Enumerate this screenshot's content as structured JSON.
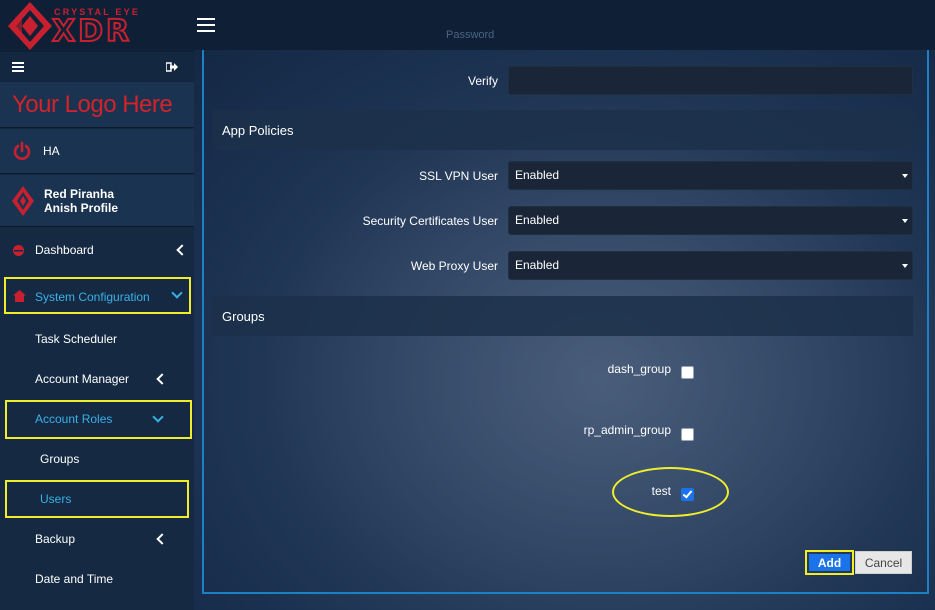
{
  "brand": {
    "top_text": "CRYSTAL EYE",
    "main_text": "XDR",
    "logo_placeholder": "Your Logo Here"
  },
  "sidebar": {
    "ha_label": "HA",
    "profile": {
      "line1": "Red Piranha",
      "line2": "Anish Profile"
    },
    "items": [
      {
        "label": "Dashboard",
        "icon": "dashboard-icon",
        "expander": "chevron-left"
      },
      {
        "label": "System Configuration",
        "icon": "home-icon",
        "expander": "chevron-down",
        "active": true
      },
      {
        "label": "Task Scheduler"
      },
      {
        "label": "Account Manager",
        "expander": "chevron-left"
      },
      {
        "label": "Account Roles",
        "expander": "chevron-down",
        "active": true
      },
      {
        "label": "Groups"
      },
      {
        "label": "Users",
        "active": true
      },
      {
        "label": "Backup",
        "expander": "chevron-left"
      },
      {
        "label": "Date and Time"
      }
    ]
  },
  "form": {
    "ghost_label": "Password",
    "verify_label": "Verify",
    "verify_value": "",
    "app_policies_title": "App Policies",
    "policies": [
      {
        "label": "SSL VPN User",
        "value": "Enabled"
      },
      {
        "label": "Security Certificates User",
        "value": "Enabled"
      },
      {
        "label": "Web Proxy User",
        "value": "Enabled"
      }
    ],
    "groups_title": "Groups",
    "groups": [
      {
        "label": "dash_group",
        "checked": false
      },
      {
        "label": "rp_admin_group",
        "checked": false
      },
      {
        "label": "test",
        "checked": true
      }
    ],
    "add_label": "Add",
    "cancel_label": "Cancel"
  },
  "colors": {
    "accent_red": "#c8202f",
    "active_blue": "#3ab0e8",
    "highlight_yellow": "#f0ee2b",
    "primary_button": "#1a73e8"
  }
}
